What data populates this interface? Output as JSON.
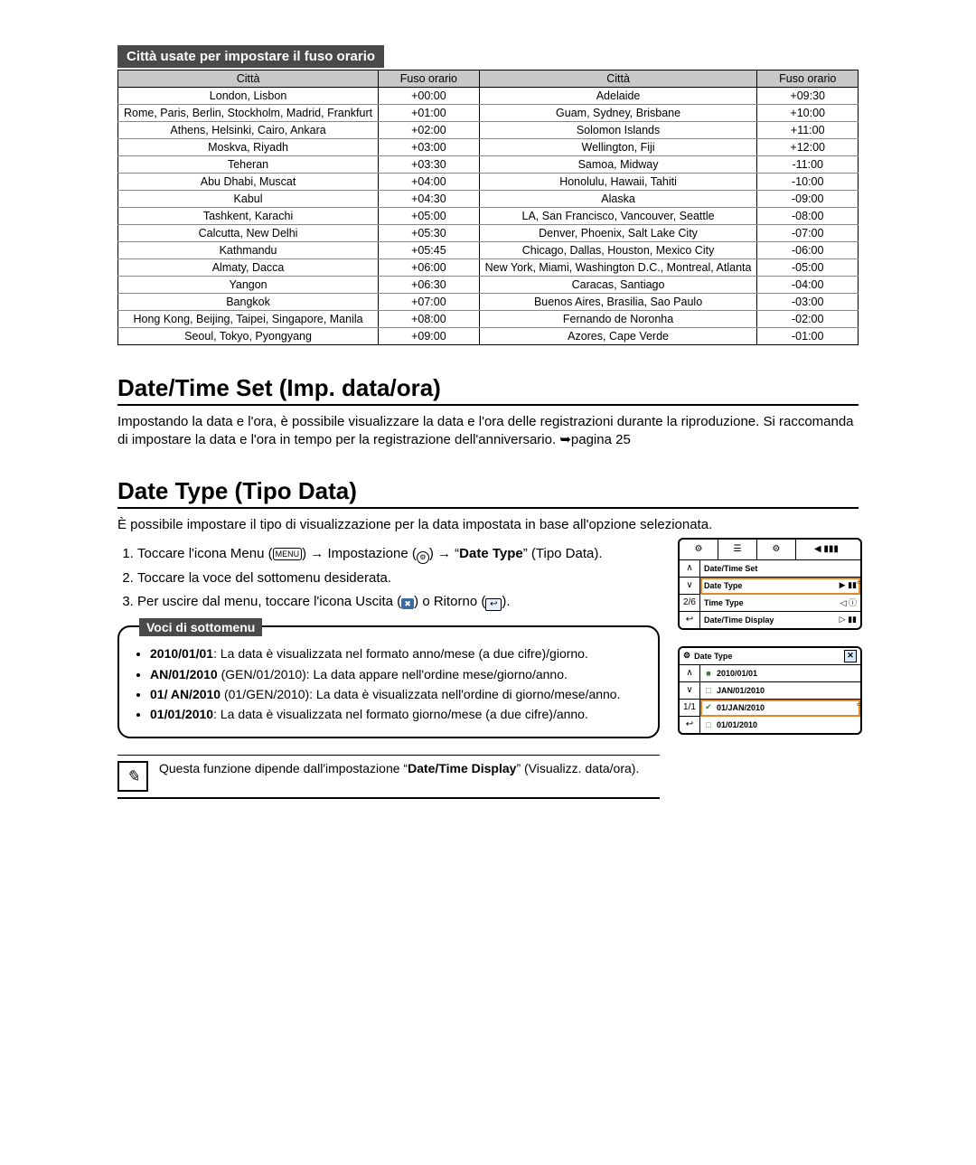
{
  "headings": {
    "table_title": "Città usate per impostare il fuso orario",
    "table_cols": [
      "Città",
      "Fuso orario",
      "Città",
      "Fuso orario"
    ],
    "h2_datetime": "Date/Time Set (Imp. data/ora)",
    "h2_datetype": "Date Type (Tipo Data)",
    "submenu_title": "Voci di sottomenu"
  },
  "timezone_rows": [
    [
      "London, Lisbon",
      "+00:00",
      "Adelaide",
      "+09:30"
    ],
    [
      "Rome, Paris, Berlin, Stockholm, Madrid, Frankfurt",
      "+01:00",
      "Guam, Sydney, Brisbane",
      "+10:00"
    ],
    [
      "Athens, Helsinki, Cairo, Ankara",
      "+02:00",
      "Solomon Islands",
      "+11:00"
    ],
    [
      "Moskva, Riyadh",
      "+03:00",
      "Wellington, Fiji",
      "+12:00"
    ],
    [
      "Teheran",
      "+03:30",
      "Samoa, Midway",
      "-11:00"
    ],
    [
      "Abu Dhabi, Muscat",
      "+04:00",
      "Honolulu, Hawaii, Tahiti",
      "-10:00"
    ],
    [
      "Kabul",
      "+04:30",
      "Alaska",
      "-09:00"
    ],
    [
      "Tashkent, Karachi",
      "+05:00",
      "LA, San Francisco, Vancouver, Seattle",
      "-08:00"
    ],
    [
      "Calcutta, New Delhi",
      "+05:30",
      "Denver, Phoenix, Salt Lake City",
      "-07:00"
    ],
    [
      "Kathmandu",
      "+05:45",
      "Chicago, Dallas, Houston, Mexico City",
      "-06:00"
    ],
    [
      "Almaty, Dacca",
      "+06:00",
      "New York, Miami, Washington D.C., Montreal, Atlanta",
      "-05:00"
    ],
    [
      "Yangon",
      "+06:30",
      "Caracas, Santiago",
      "-04:00"
    ],
    [
      "Bangkok",
      "+07:00",
      "Buenos Aires, Brasilia, Sao Paulo",
      "-03:00"
    ],
    [
      "Hong Kong, Beijing, Taipei, Singapore, Manila",
      "+08:00",
      "Fernando de Noronha",
      "-02:00"
    ],
    [
      "Seoul, Tokyo, Pyongyang",
      "+09:00",
      "Azores, Cape Verde",
      "-01:00"
    ]
  ],
  "paragraphs": {
    "datetime": "Impostando la data e l'ora, è possibile visualizzare la data e l'ora delle registrazioni durante la riproduzione. Si raccomanda di impostare la data e l'ora in tempo per la registrazione dell'anniversario. ➥pagina 25",
    "datetype": "È possibile impostare il tipo di visualizzazione per la data impostata in base all'opzione selezionata."
  },
  "steps": {
    "s1a": "Toccare l'icona Menu (",
    "s1b": ") → Impostazione (",
    "s1c": ") → “",
    "s1bold": "Date Type",
    "s1d": "” (Tipo Data).",
    "s2": "Toccare la voce del sottomenu desiderata.",
    "s3a": "Per uscire dal menu, toccare l'icona Uscita (",
    "s3b": ") o Ritorno (",
    "s3c": ")."
  },
  "icon_labels": {
    "menu": "MENU",
    "gear": "⚙",
    "exit": "✖",
    "return": "↩"
  },
  "submenu_items": [
    {
      "b": "2010/01/01",
      "t": ": La data è visualizzata nel formato anno/mese (a due cifre)/giorno."
    },
    {
      "b": " AN/01/2010",
      "t": " (GEN/01/2010): La data appare nell'ordine mese/giorno/anno."
    },
    {
      "b": "01/ AN/2010",
      "t": " (01/GEN/2010): La data è visualizzata nell'ordine di giorno/mese/anno."
    },
    {
      "b": "01/01/2010",
      "t": ": La data è visualizzata nel formato giorno/mese (a due cifre)/anno."
    }
  ],
  "note": {
    "t1": "Questa funzione dipende dall'impostazione “",
    "b": "Date/Time Display",
    "t2": "” (Visualizz. data/ora)."
  },
  "ui_panel_1": {
    "side": [
      "∧",
      "∨",
      "2/6",
      "↩"
    ],
    "top": [
      "⚙",
      "☰",
      "⚙",
      "◀ ▮▮▮"
    ],
    "rows": [
      {
        "label": "Date/Time Set",
        "hl": false,
        "tail": ""
      },
      {
        "label": "Date Type",
        "hl": true,
        "tail": "▶ ▮▮"
      },
      {
        "label": "Time Type",
        "hl": false,
        "tail": "◁ ⓘ"
      },
      {
        "label": "Date/Time Display",
        "hl": false,
        "tail": "▷ ▮▮"
      }
    ]
  },
  "ui_panel_2": {
    "title": "Date Type",
    "title_icon": "⚙",
    "side": [
      "∧",
      "∨",
      "1/1",
      "↩"
    ],
    "rows": [
      {
        "icon": "■",
        "label": "2010/01/01",
        "hl": false
      },
      {
        "icon": "□",
        "label": "JAN/01/2010",
        "hl": false
      },
      {
        "icon": "✔",
        "label": "01/JAN/2010",
        "hl": true
      },
      {
        "icon": "□",
        "label": "01/01/2010",
        "hl": false
      }
    ]
  }
}
